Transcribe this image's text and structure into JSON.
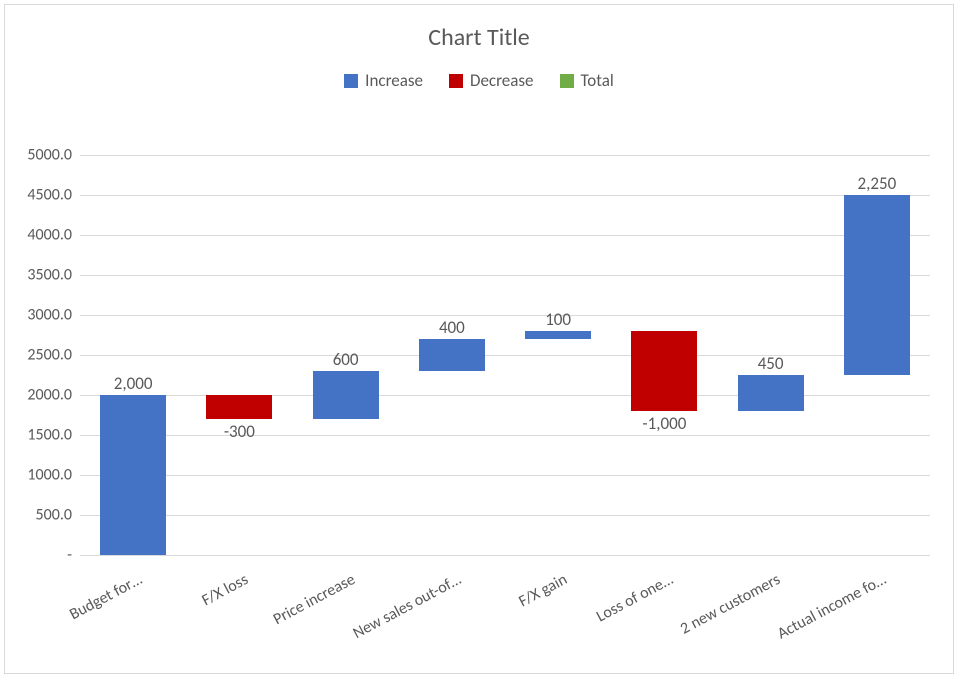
{
  "title": "Chart Title",
  "legend": [
    {
      "name": "Increase",
      "color": "#4472C4"
    },
    {
      "name": "Decrease",
      "color": "#C00000"
    },
    {
      "name": "Total",
      "color": "#70AD47"
    }
  ],
  "chart_data": {
    "type": "bar",
    "subtype": "waterfall",
    "title": "Chart Title",
    "xlabel": "",
    "ylabel": "",
    "ylim": [
      0,
      5000
    ],
    "ytick_step": 500,
    "categories": [
      "Budget for…",
      "F/X loss",
      "Price increase",
      "New sales out-of…",
      "F/X gain",
      "Loss of one…",
      "2 new customers",
      "Actual income fo…"
    ],
    "bars": [
      {
        "label": "2,000",
        "value": 2000,
        "from": 0,
        "to": 2000,
        "kind": "increase"
      },
      {
        "label": "-300",
        "value": -300,
        "from": 2000,
        "to": 1700,
        "kind": "decrease"
      },
      {
        "label": "600",
        "value": 600,
        "from": 1700,
        "to": 2300,
        "kind": "increase"
      },
      {
        "label": "400",
        "value": 400,
        "from": 2300,
        "to": 2700,
        "kind": "increase"
      },
      {
        "label": "100",
        "value": 100,
        "from": 2700,
        "to": 2800,
        "kind": "increase"
      },
      {
        "label": "-1,000",
        "value": -1000,
        "from": 2800,
        "to": 1800,
        "kind": "decrease"
      },
      {
        "label": "450",
        "value": 450,
        "from": 1800,
        "to": 2250,
        "kind": "increase"
      },
      {
        "label": "2,250",
        "value": 2250,
        "from": 2250,
        "to": 4500,
        "kind": "increase"
      }
    ],
    "colors": {
      "increase": "#4472C4",
      "decrease": "#C00000",
      "total": "#70AD47"
    }
  },
  "y_ticks": [
    {
      "value": 0,
      "label": "-"
    },
    {
      "value": 500,
      "label": "500.0"
    },
    {
      "value": 1000,
      "label": "1000.0"
    },
    {
      "value": 1500,
      "label": "1500.0"
    },
    {
      "value": 2000,
      "label": "2000.0"
    },
    {
      "value": 2500,
      "label": "2500.0"
    },
    {
      "value": 3000,
      "label": "3000.0"
    },
    {
      "value": 3500,
      "label": "3500.0"
    },
    {
      "value": 4000,
      "label": "4000.0"
    },
    {
      "value": 4500,
      "label": "4500.0"
    },
    {
      "value": 5000,
      "label": "5000.0"
    }
  ]
}
